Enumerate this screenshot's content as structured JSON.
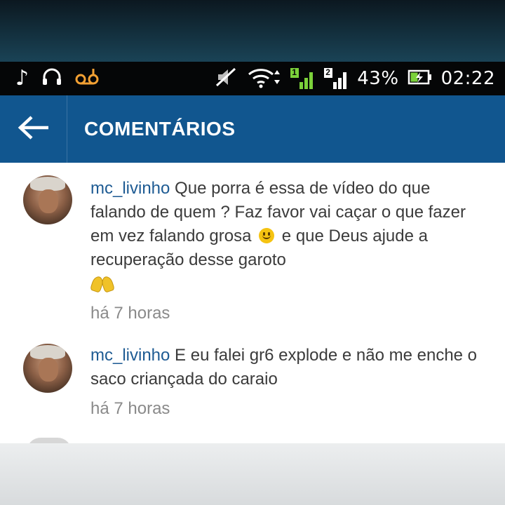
{
  "status_bar": {
    "music_icon": "music-note-icon",
    "headset_icon": "headphones-icon",
    "voicemail_icon": "voicemail-icon",
    "mute_icon": "muted-icon",
    "wifi_icon": "wifi-icon",
    "sim1_label": "1",
    "sim2_label": "2",
    "battery_percent": "43%",
    "time": "02:22"
  },
  "header": {
    "title": "COMENTÁRIOS",
    "back_icon": "arrow-left-icon"
  },
  "comments": [
    {
      "username": "mc_livinho",
      "text_part1": " Que porra é essa de vídeo do que falando de quem ? Faz favor vai caçar o que fazer em vez falando grosa",
      "text_part2": " e que Deus ajude a recuperação desse garoto",
      "emoji_1": "smiley-emoji",
      "emoji_2": "praying-hands-emoji",
      "timestamp": "há 7 horas"
    },
    {
      "username": "mc_livinho",
      "text": " E eu falei gr6 explode e não me enche o saco criançada do caraio",
      "timestamp": "há 7 horas"
    }
  ],
  "colors": {
    "action_bar": "#11568f",
    "username": "#1e5b93",
    "status_bar": "#050607"
  }
}
